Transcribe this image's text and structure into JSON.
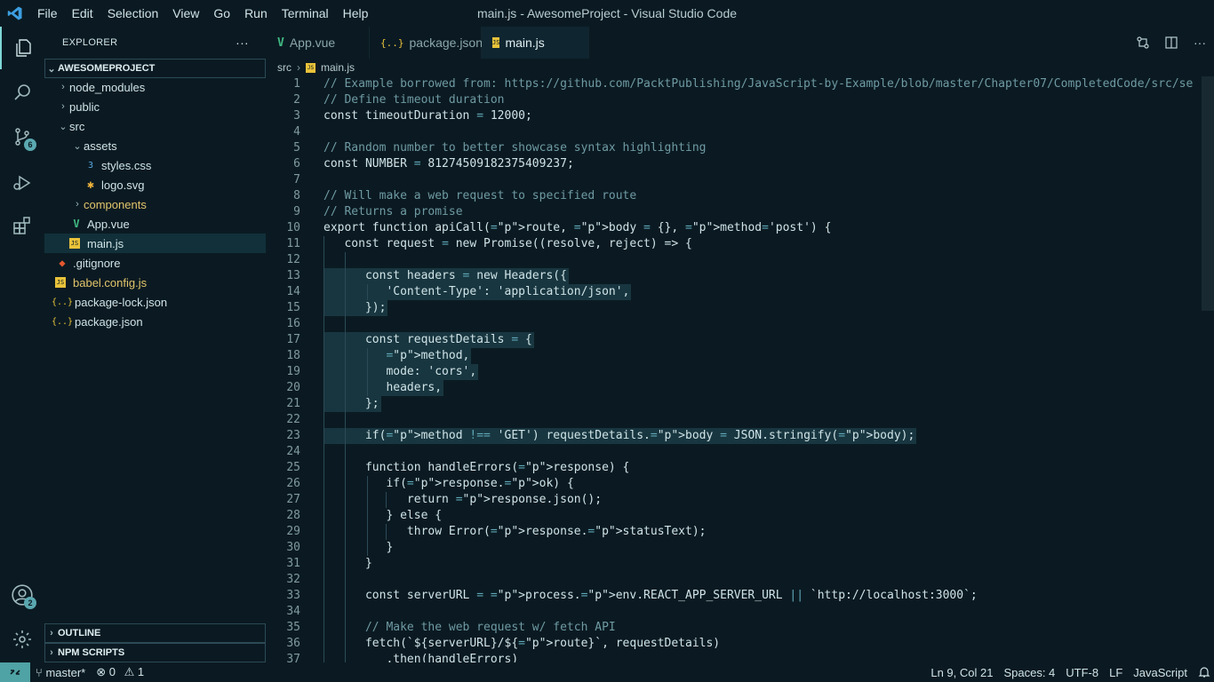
{
  "titlebar": {
    "menu": [
      "File",
      "Edit",
      "Selection",
      "View",
      "Go",
      "Run",
      "Terminal",
      "Help"
    ],
    "window_title": "main.js - AwesomeProject - Visual Studio Code"
  },
  "activity": {
    "source_control_badge": "6",
    "accounts_badge": "2"
  },
  "sidebar": {
    "title": "EXPLORER",
    "more": "···",
    "root": "AWESOMEPROJECT",
    "items": [
      {
        "label": "node_modules",
        "kind": "folder"
      },
      {
        "label": "public",
        "kind": "folder"
      },
      {
        "label": "src",
        "kind": "folder-open"
      },
      {
        "label": "assets",
        "kind": "folder-open"
      },
      {
        "label": "styles.css",
        "kind": "css"
      },
      {
        "label": "logo.svg",
        "kind": "svg"
      },
      {
        "label": "components",
        "kind": "folder"
      },
      {
        "label": "App.vue",
        "kind": "vue"
      },
      {
        "label": "main.js",
        "kind": "js"
      },
      {
        "label": ".gitignore",
        "kind": "git"
      },
      {
        "label": "babel.config.js",
        "kind": "js"
      },
      {
        "label": "package-lock.json",
        "kind": "json"
      },
      {
        "label": "package.json",
        "kind": "json"
      }
    ],
    "outline": "OUTLINE",
    "npm_scripts": "NPM SCRIPTS"
  },
  "tabs": [
    {
      "label": "App.vue",
      "icon": "V"
    },
    {
      "label": "package.json",
      "icon": "{..}"
    },
    {
      "label": "main.js",
      "icon": "JS"
    }
  ],
  "breadcrumb": {
    "folder": "src",
    "file": "main.js"
  },
  "code": [
    "// Example borrowed from: https://github.com/PacktPublishing/JavaScript-by-Example/blob/master/Chapter07/CompletedCode/src/se",
    "// Define timeout duration",
    "const timeoutDuration = 12000;",
    "",
    "// Random number to better showcase syntax highlighting",
    "const NUMBER = 812745091823754O9237;",
    "",
    "// Will make a web request to specified route",
    "// Returns a promise",
    "export function apiCall(route, body = {}, method='post') {",
    "   const request = new Promise((resolve, reject) => {",
    "",
    "      const headers = new Headers({",
    "         'Content-Type': 'application/json',",
    "      });",
    "",
    "      const requestDetails = {",
    "         method,",
    "         mode: 'cors',",
    "         headers,",
    "      };",
    "",
    "      if(method !== 'GET') requestDetails.body = JSON.stringify(body);",
    "",
    "      function handleErrors(response) {",
    "         if(response.ok) {",
    "            return response.json();",
    "         } else {",
    "            throw Error(response.statusText);",
    "         }",
    "      }",
    "",
    "      const serverURL = process.env.REACT_APP_SERVER_URL || `http://localhost:3000`;",
    "",
    "      // Make the web request w/ fetch API",
    "      fetch(`${serverURL}/${route}`, requestDetails)",
    "         .then(handleErrors)"
  ],
  "statusbar": {
    "branch": "master*",
    "errors": "0",
    "warnings": "1",
    "position": "Ln 9, Col 21",
    "spaces": "Spaces: 4",
    "encoding": "UTF-8",
    "eol": "LF",
    "language": "JavaScript"
  }
}
